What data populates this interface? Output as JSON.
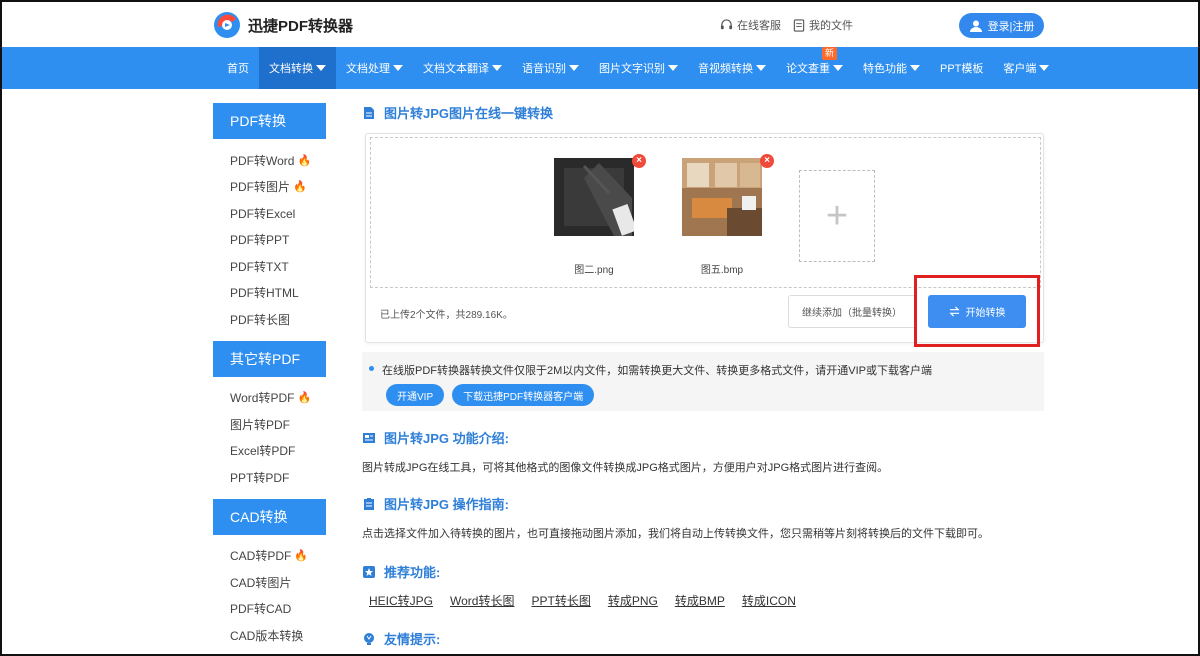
{
  "header": {
    "logo_text": "迅捷PDF转换器",
    "online_service": "在线客服",
    "my_files": "我的文件",
    "login": "登录|注册"
  },
  "nav": {
    "items": [
      {
        "label": "首页",
        "caret": false
      },
      {
        "label": "文档转换",
        "caret": true,
        "active": true
      },
      {
        "label": "文档处理",
        "caret": true
      },
      {
        "label": "文档文本翻译",
        "caret": true
      },
      {
        "label": "语音识别",
        "caret": true
      },
      {
        "label": "图片文字识别",
        "caret": true
      },
      {
        "label": "音视频转换",
        "caret": true
      },
      {
        "label": "论文查重",
        "caret": true,
        "badge": "新"
      },
      {
        "label": "特色功能",
        "caret": true
      },
      {
        "label": "PPT模板",
        "caret": false
      },
      {
        "label": "客户端",
        "caret": true
      }
    ]
  },
  "sidebar": {
    "groups": [
      {
        "title": "PDF转换",
        "items": [
          {
            "label": "PDF转Word",
            "hot": true
          },
          {
            "label": "PDF转图片",
            "hot": true
          },
          {
            "label": "PDF转Excel",
            "hot": false
          },
          {
            "label": "PDF转PPT",
            "hot": false
          },
          {
            "label": "PDF转TXT",
            "hot": false
          },
          {
            "label": "PDF转HTML",
            "hot": false
          },
          {
            "label": "PDF转长图",
            "hot": false
          }
        ]
      },
      {
        "title": "其它转PDF",
        "items": [
          {
            "label": "Word转PDF",
            "hot": true
          },
          {
            "label": "图片转PDF",
            "hot": false
          },
          {
            "label": "Excel转PDF",
            "hot": false
          },
          {
            "label": "PPT转PDF",
            "hot": false
          }
        ]
      },
      {
        "title": "CAD转换",
        "items": [
          {
            "label": "CAD转PDF",
            "hot": true
          },
          {
            "label": "CAD转图片",
            "hot": false
          },
          {
            "label": "PDF转CAD",
            "hot": false
          },
          {
            "label": "CAD版本转换",
            "hot": false
          }
        ]
      }
    ]
  },
  "main": {
    "tool_title": "图片转JPG图片在线一键转换",
    "files": [
      {
        "name": "图二.png"
      },
      {
        "name": "图五.bmp"
      }
    ],
    "upload_info": "已上传2个文件，共289.16K。",
    "add_more": "继续添加（批量转换）",
    "start": "开始转换",
    "notice": "在线版PDF转换器转换文件仅限于2M以内文件，如需转换更大文件、转换更多格式文件，请开通VIP或下载客户端",
    "vip_btn": "开通VIP",
    "download_btn": "下载迅捷PDF转换器客户端",
    "intro_title": "图片转JPG 功能介绍:",
    "intro_text": "图片转成JPG在线工具，可将其他格式的图像文件转换成JPG格式图片，方便用户对JPG格式图片进行查阅。",
    "guide_title": "图片转JPG 操作指南:",
    "guide_text": "点击选择文件加入待转换的图片，也可直接拖动图片添加，我们将自动上传转换文件，您只需稍等片刻将转换后的文件下载即可。",
    "rec_title": "推荐功能:",
    "rec_links": [
      "HEIC转JPG",
      "Word转长图",
      "PPT转长图",
      "转成PNG",
      "转成BMP",
      "转成ICON"
    ],
    "tips_title": "友情提示:"
  },
  "colors": {
    "primary": "#2f8ff0",
    "nav_active": "#1f6fcc",
    "delete": "#f04a3a",
    "highlight": "#e02020",
    "hot": "#ff6a2a"
  }
}
